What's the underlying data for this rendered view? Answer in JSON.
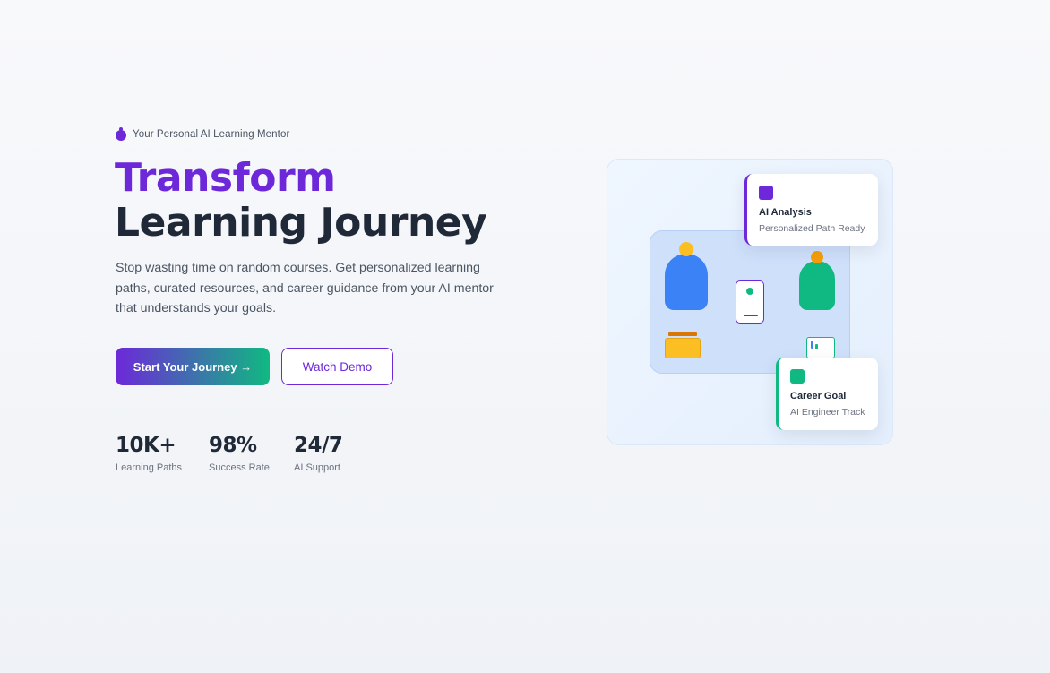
{
  "hero": {
    "eyebrow_icon": "mentor-icon",
    "eyebrow": "Your Personal AI Learning Mentor",
    "headline_line1": "Transform",
    "headline_line2": "Learning Journey",
    "lead": "Stop wasting time on random courses. Get personalized learning paths, curated resources, and career guidance from your AI mentor that understands your goals.",
    "primary_button": "Start Your Journey →",
    "secondary_button": "Watch Demo"
  },
  "stats": [
    {
      "value": "10K+",
      "label": "Learning Paths"
    },
    {
      "value": "98%",
      "label": "Success Rate"
    },
    {
      "value": "24/7",
      "label": "AI Support"
    }
  ],
  "illustration": {
    "analysis_card": {
      "title": "AI Analysis",
      "subtitle": "Personalized Path Ready",
      "accent": "#6d28d9"
    },
    "goal_card": {
      "title": "Career Goal",
      "subtitle": "AI Engineer Track",
      "accent": "#10b981"
    }
  },
  "colors": {
    "brand_purple": "#6d28d9",
    "brand_green": "#10b981",
    "text_dark": "#1f2937",
    "text_muted": "#4b5563"
  }
}
